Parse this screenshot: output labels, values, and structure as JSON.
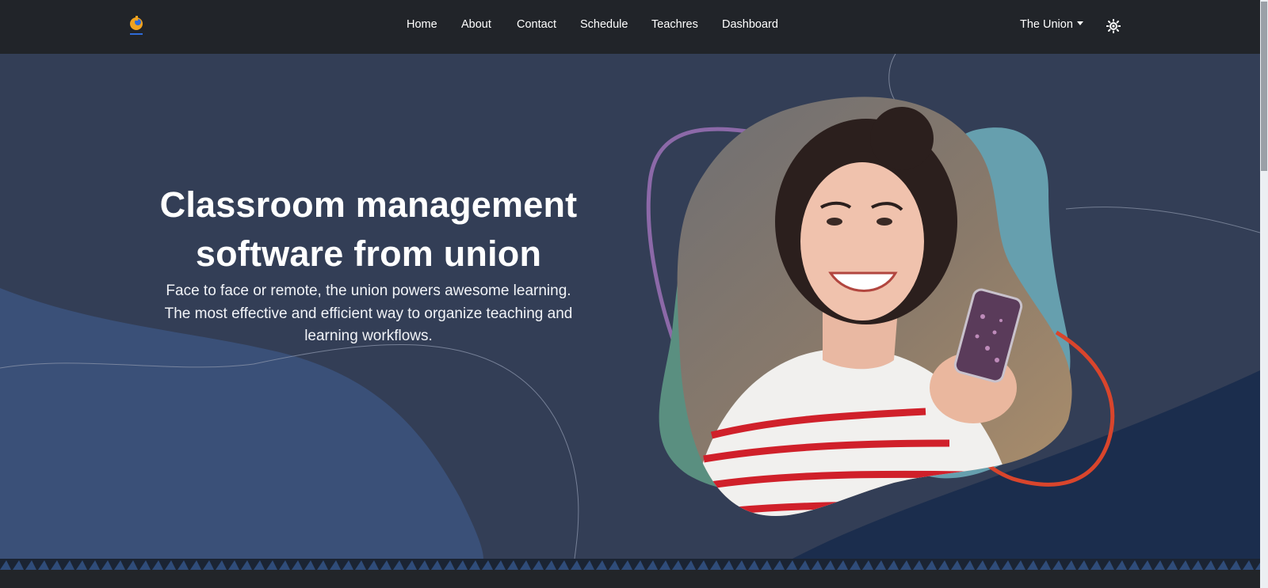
{
  "brand": {
    "logo_icon": "union-logo-icon",
    "logo_colors": [
      "#f0a21f",
      "#2f6bd8"
    ]
  },
  "nav": {
    "links": [
      {
        "label": "Home"
      },
      {
        "label": "About"
      },
      {
        "label": "Contact"
      },
      {
        "label": "Schedule"
      },
      {
        "label": "Teachres"
      },
      {
        "label": "Dashboard"
      }
    ],
    "account_label": "The Union",
    "theme_icon": "sun-icon"
  },
  "hero": {
    "title": "Classroom management software from union",
    "subtitle": "Face to face or remote, the union powers awesome learning. The most effective and efficient way to organize teaching and learning workflows.",
    "image_subject": "smiling-girl-with-phone-photo"
  },
  "colors": {
    "navbar_bg": "#212429",
    "hero_bg": "#333e56",
    "hero_blob_left": "#3a5078",
    "hero_blob_right": "#1b2d4d",
    "accent_purple": "#8c69a8",
    "accent_orange": "#d9452c",
    "accent_green": "#5a8f80",
    "accent_teal": "#669fae"
  }
}
